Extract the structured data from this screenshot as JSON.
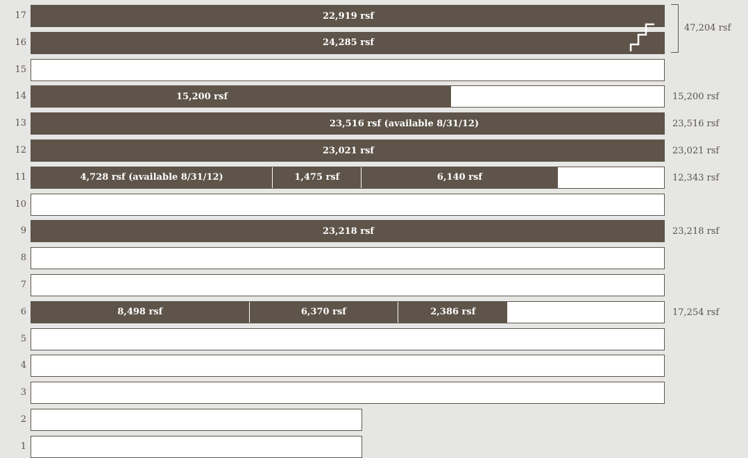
{
  "colors": {
    "occupied": "#5e5449",
    "vacant": "#ffffff",
    "background": "#e6e7e5"
  },
  "floors": [
    {
      "num": "17",
      "width": "full",
      "segments": [
        {
          "fraction": 1.0,
          "label": "22,919 rsf"
        }
      ]
    },
    {
      "num": "16",
      "width": "full",
      "segments": [
        {
          "fraction": 1.0,
          "label": "24,285 rsf"
        }
      ]
    },
    {
      "num": "15",
      "width": "full",
      "segments": []
    },
    {
      "num": "14",
      "width": "full",
      "segments": [
        {
          "fraction": 0.662,
          "label": "15,200 rsf"
        }
      ]
    },
    {
      "num": "13",
      "width": "full",
      "segments": [
        {
          "fraction": 1.0,
          "label": "23,516 rsf (available 8/31/12)"
        }
      ]
    },
    {
      "num": "12",
      "width": "full",
      "segments": [
        {
          "fraction": 1.0,
          "label": "23,021 rsf"
        }
      ]
    },
    {
      "num": "11",
      "width": "full",
      "segments": [
        {
          "fraction": 0.38,
          "label": "4,728 rsf (available 8/31/12)"
        },
        {
          "fraction": 0.14,
          "label": "1,475 rsf"
        },
        {
          "fraction": 0.31,
          "label": "6,140 rsf"
        }
      ]
    },
    {
      "num": "10",
      "width": "full",
      "segments": []
    },
    {
      "num": "9",
      "width": "full",
      "segments": [
        {
          "fraction": 1.0,
          "label": "23,218 rsf"
        }
      ]
    },
    {
      "num": "8",
      "width": "full",
      "segments": []
    },
    {
      "num": "7",
      "width": "full",
      "segments": []
    },
    {
      "num": "6",
      "width": "full",
      "segments": [
        {
          "fraction": 0.343,
          "label": "8,498 rsf"
        },
        {
          "fraction": 0.235,
          "label": "6,370 rsf"
        },
        {
          "fraction": 0.173,
          "label": "2,386 rsf"
        }
      ]
    },
    {
      "num": "5",
      "width": "full",
      "segments": []
    },
    {
      "num": "4",
      "width": "full",
      "segments": []
    },
    {
      "num": "3",
      "width": "full",
      "segments": []
    },
    {
      "num": "2",
      "width": "half",
      "segments": []
    },
    {
      "num": "1",
      "width": "half",
      "segments": []
    }
  ],
  "totals": [
    {
      "floor": "16-17",
      "label": "47,204 rsf"
    },
    {
      "floor": "14",
      "label": "15,200 rsf"
    },
    {
      "floor": "13",
      "label": "23,516 rsf"
    },
    {
      "floor": "12",
      "label": "23,021 rsf"
    },
    {
      "floor": "11",
      "label": "12,343 rsf"
    },
    {
      "floor": "9",
      "label": "23,218 rsf"
    },
    {
      "floor": "6",
      "label": "17,254 rsf"
    }
  ],
  "icons": {
    "stair": "staircase-icon"
  }
}
